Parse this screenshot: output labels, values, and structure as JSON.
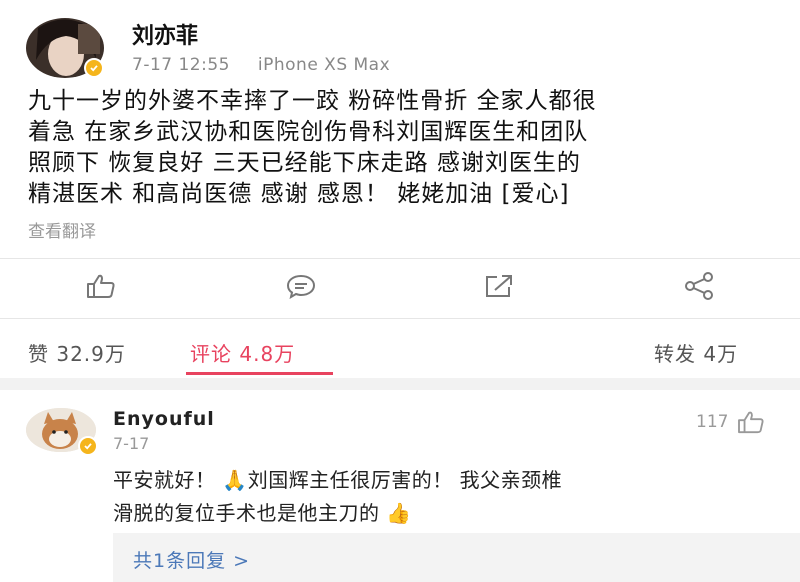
{
  "post": {
    "username": "刘亦菲",
    "date": "7-17 12:55",
    "device": "iPhone XS Max",
    "lines": [
      "九十一岁的外婆不幸摔了一跤 粉碎性骨折 全家人都很",
      "着急 在家乡武汉协和医院创伤骨科刘国辉医生和团队",
      "照顾下 恢复良好 三天已经能下床走路 感谢刘医生的",
      "精湛医术 和高尚医德 感谢 感恩！ 姥姥加油 [爱心]"
    ],
    "translate_label": "查看翻译"
  },
  "actions": [
    {
      "icon": "thumbs-up-icon"
    },
    {
      "icon": "comment-icon"
    },
    {
      "icon": "forward-icon"
    },
    {
      "icon": "share-icon"
    }
  ],
  "stats": {
    "likes": "赞 32.9万",
    "comments": "评论 4.8万",
    "reposts": "转发 4万"
  },
  "comment": {
    "username": "Enyouful",
    "date": "7-17",
    "likes": "117",
    "line1": "平安就好！ 🙏刘国辉主任很厉害的！ 我父亲颈椎",
    "line2": "滑脱的复位手术也是他主刀的 👍",
    "reply_link": "共1条回复 >"
  },
  "colors": {
    "accent": "#e8435f",
    "link": "#4b78b8",
    "badge": "#f5b51c"
  }
}
